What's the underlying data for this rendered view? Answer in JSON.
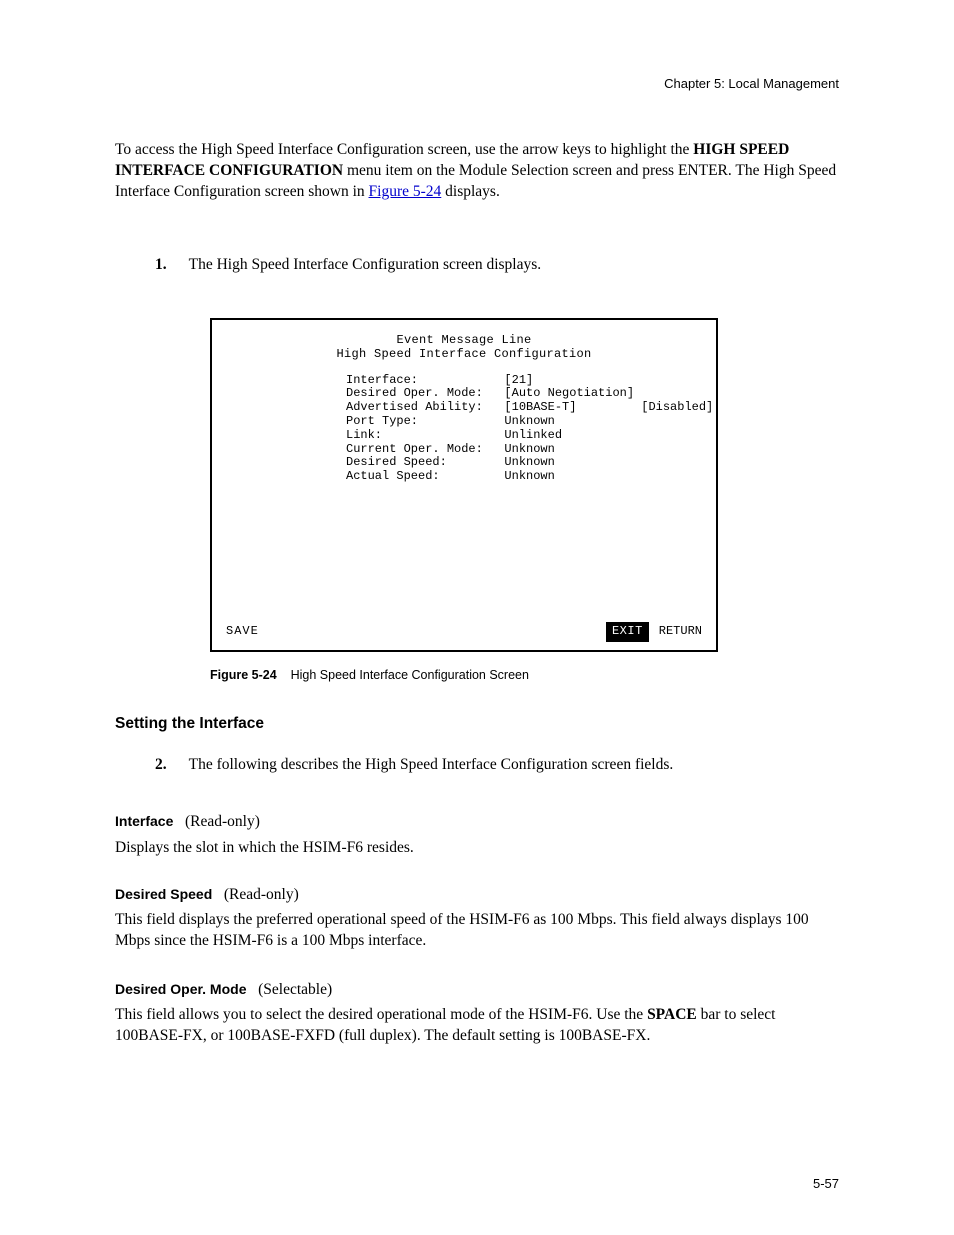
{
  "header": {
    "right": "Chapter 5: Local Management"
  },
  "intro": {
    "text_before_link": "To access the High Speed Interface Configuration screen, use the arrow keys to highlight the ",
    "bold1": "HIGH SPEED INTERFACE CONFIGURATION",
    "text_mid": " menu item on the Module Selection screen and press ENTER. The High Speed Interface Configuration screen shown in ",
    "link_text": "Figure 5-24",
    "text_after_link": " displays."
  },
  "step1": {
    "num": "1.",
    "text": "The High Speed Interface Configuration screen displays."
  },
  "screen": {
    "title": "Event Message Line",
    "subtitle": "High Speed Interface Configuration",
    "menu": [
      "Interface:            [21]",
      "Desired Oper. Mode:   [Auto Negotiation]",
      "",
      "Advertised Ability:   [10BASE-T]         [Disabled]",
      "",
      "Port Type:            Unknown",
      "Link:                 Unlinked",
      "Current Oper. Mode:   Unknown",
      "Desired Speed:        Unknown",
      "Actual Speed:         Unknown"
    ],
    "footer_left": "SAVE",
    "footer_exit": "EXIT",
    "footer_return": "RETURN"
  },
  "caption": {
    "fig": "Figure 5-24",
    "text": "High Speed Interface Configuration Screen"
  },
  "sub_heading": "Setting the Interface",
  "step2": {
    "num": "2.",
    "text": "The following describes the High Speed Interface Configuration screen fields."
  },
  "iface": {
    "name": "Interface",
    "read": "(Read-only)",
    "body": "Displays the slot in which the HSIM-F6 resides."
  },
  "speed": {
    "name": "Desired Speed",
    "read": "(Read-only)",
    "body": "This field displays the preferred operational speed of the HSIM-F6 as 100 Mbps. This field always displays 100 Mbps since the HSIM-F6 is a 100 Mbps interface."
  },
  "mode": {
    "name": "Desired Oper. Mode",
    "sel": "(Selectable)",
    "body_before_bold": "This field allows you to select the desired operational mode of the HSIM-F6. Use the ",
    "bold": "SPACE",
    "body_after_bold": " bar to select 100BASE-FX, or 100BASE-FXFD (full duplex). The default setting is 100BASE-FX."
  },
  "page_number": "5-57"
}
